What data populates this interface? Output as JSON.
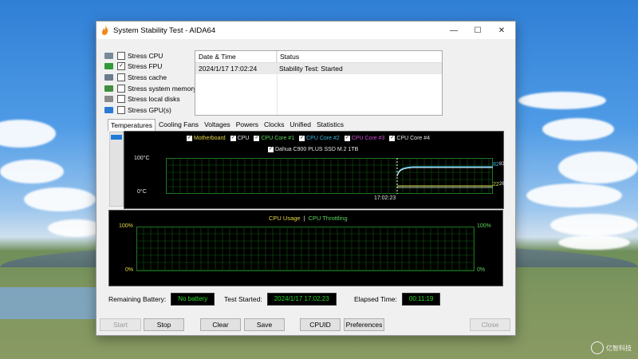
{
  "window": {
    "title": "System Stability Test - AIDA64",
    "minimize": "—",
    "maximize": "☐",
    "close": "✕"
  },
  "stress": [
    {
      "label": "Stress CPU",
      "checked": false,
      "icon": "cpu-icon",
      "color": "#7b8a9a"
    },
    {
      "label": "Stress FPU",
      "checked": true,
      "icon": "fpu-icon",
      "color": "#2f9a3a"
    },
    {
      "label": "Stress cache",
      "checked": false,
      "icon": "cache-icon",
      "color": "#6a7b8c"
    },
    {
      "label": "Stress system memory",
      "checked": false,
      "icon": "memory-icon",
      "color": "#3f8f3f"
    },
    {
      "label": "Stress local disks",
      "checked": false,
      "icon": "disk-icon",
      "color": "#8a8a8a"
    },
    {
      "label": "Stress GPU(s)",
      "checked": false,
      "icon": "gpu-icon",
      "color": "#2a7bd6"
    }
  ],
  "log": {
    "headers": [
      "Date & Time",
      "Status"
    ],
    "rows": [
      {
        "time": "2024/1/17 17:02:24",
        "status": "Stability Test: Started"
      }
    ]
  },
  "tabs": [
    "Temperatures",
    "Cooling Fans",
    "Voltages",
    "Powers",
    "Clocks",
    "Unified",
    "Statistics"
  ],
  "active_tab": "Temperatures",
  "temp_chart": {
    "legend": [
      {
        "label": "Motherboard",
        "color": "#e8d84a"
      },
      {
        "label": "CPU",
        "color": "#e8e8e8"
      },
      {
        "label": "CPU Core #1",
        "color": "#5cd65c"
      },
      {
        "label": "CPU Core #2",
        "color": "#3ab8e8"
      },
      {
        "label": "CPU Core #3",
        "color": "#d64ad6"
      },
      {
        "label": "CPU Core #4",
        "color": "#e8e8e8"
      }
    ],
    "legend2": {
      "label": "Dahua C900 PLUS SSD M.2 1TB",
      "color": "#e8e8e8"
    },
    "y_top": "100°C",
    "y_bottom": "0°C",
    "time_label": "17:02:23",
    "right_values_top": "82",
    "right_values_top2": "83",
    "right_values_bottom": "22",
    "right_values_bottom2": "26"
  },
  "usage_chart": {
    "title_left": "CPU Usage",
    "separator": "|",
    "title_right": "CPU Throttling",
    "title_left_color": "#e8d84a",
    "title_right_color": "#5cd65c",
    "left_top": "100%",
    "left_bottom": "0%",
    "right_top": "100%",
    "right_bottom": "0%"
  },
  "status": {
    "battery_label": "Remaining Battery:",
    "battery_value": "No battery",
    "started_label": "Test Started:",
    "started_value": "2024/1/17 17:02:23",
    "elapsed_label": "Elapsed Time:",
    "elapsed_value": "00:11:19"
  },
  "buttons": {
    "start": "Start",
    "stop": "Stop",
    "clear": "Clear",
    "save": "Save",
    "cpuid": "CPUID",
    "preferences": "Preferences",
    "close": "Close"
  },
  "watermark": "亿智科技"
}
